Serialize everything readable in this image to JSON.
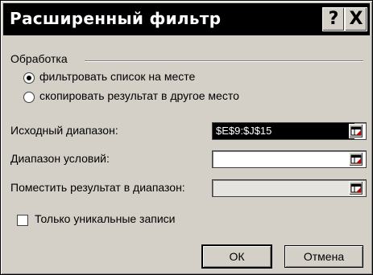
{
  "window": {
    "title": "Расширенный фильтр",
    "help_label": "?",
    "close_label": "X"
  },
  "processing": {
    "group_label": "Обработка",
    "options": [
      {
        "label": "фильтровать список на месте",
        "selected": true
      },
      {
        "label": "скопировать результат в другое место",
        "selected": false
      }
    ]
  },
  "fields": {
    "source_label": "Исходный диапазон:",
    "source_value": "$E$9:$J$15",
    "criteria_label": "Диапазон условий:",
    "criteria_value": "",
    "copy_to_label": "Поместить результат в диапазон:",
    "copy_to_value": ""
  },
  "unique": {
    "label": "Только уникальные записи",
    "checked": false
  },
  "buttons": {
    "ok": "ОК",
    "cancel": "Отмена"
  },
  "icons": {
    "range_picker": "range-select-icon"
  }
}
